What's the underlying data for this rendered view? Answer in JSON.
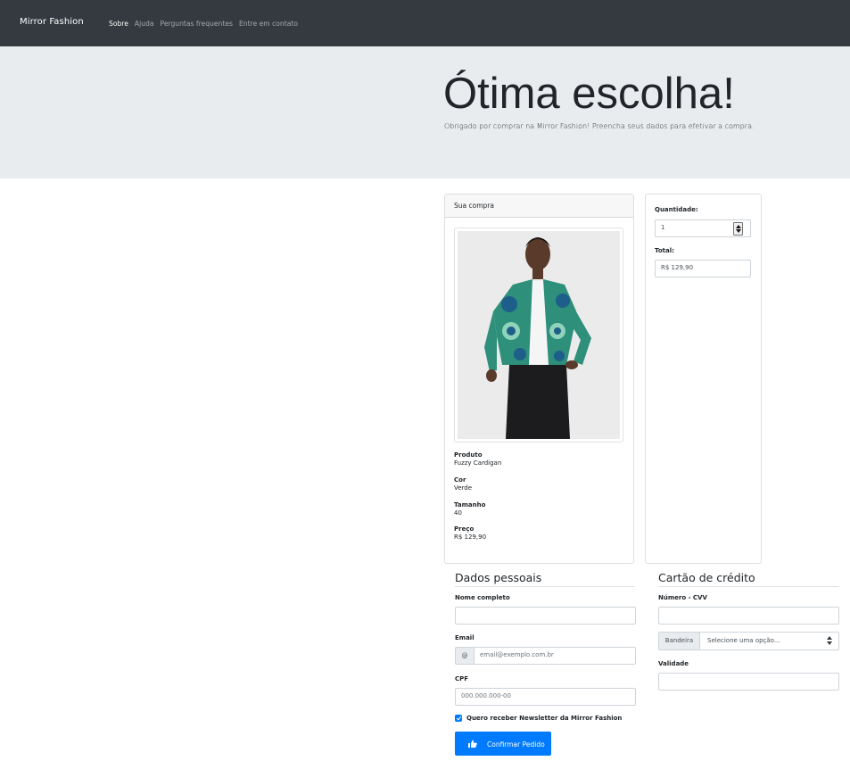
{
  "navbar": {
    "brand": "Mirror Fashion",
    "links": [
      "Sobre",
      "Ajuda",
      "Perguntas frequentes",
      "Entre em contato"
    ]
  },
  "jumbotron": {
    "title": "Ótima escolha!",
    "subtitle": "Obrigado por comprar na Mirror Fashion! Preencha seus dados para efetivar a compra."
  },
  "purchase": {
    "header": "Sua compra",
    "details": [
      {
        "label": "Produto",
        "value": "Fuzzy Cardigan"
      },
      {
        "label": "Cor",
        "value": "Verde"
      },
      {
        "label": "Tamanho",
        "value": "40"
      },
      {
        "label": "Preço",
        "value": "R$ 129,90"
      }
    ]
  },
  "order": {
    "quantity_label": "Quantidade:",
    "quantity_value": "1",
    "total_label": "Total:",
    "total_value": "R$ 129,90"
  },
  "personal": {
    "title": "Dados pessoais",
    "name_label": "Nome completo",
    "email_label": "Email",
    "email_addon": "@",
    "email_placeholder": "email@exemplo.com.br",
    "cpf_label": "CPF",
    "cpf_placeholder": "000.000.000-00",
    "newsletter_label": "Quero receber Newsletter da Mirror Fashion",
    "newsletter_checked": true,
    "submit_label": "Confirmar Pedido"
  },
  "card": {
    "title": "Cartão de crédito",
    "number_label": "Número - CVV",
    "brand_addon": "Bandeira",
    "brand_select": "Selecione uma opção...",
    "validity_label": "Validade"
  },
  "colors": {
    "navbar": "#343a40",
    "jumbotron": "#e9ecef",
    "primary": "#007bff"
  }
}
